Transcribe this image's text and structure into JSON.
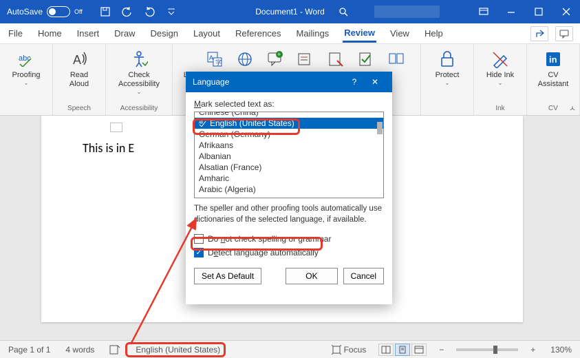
{
  "titlebar": {
    "autosave_label": "AutoSave",
    "autosave_state": "Off",
    "document_title": "Document1 - Word"
  },
  "tabs": {
    "file": "File",
    "home": "Home",
    "insert": "Insert",
    "draw": "Draw",
    "design": "Design",
    "layout": "Layout",
    "references": "References",
    "mailings": "Mailings",
    "review": "Review",
    "view": "View",
    "help": "Help"
  },
  "ribbon": {
    "proofing": {
      "button": "Proofing",
      "group": ""
    },
    "speech": {
      "button": "Read Aloud",
      "group": "Speech"
    },
    "accessibility": {
      "button": "Check Accessibility",
      "group": "Accessibility"
    },
    "language": {
      "button": "Lang",
      "group": ""
    },
    "protect": {
      "button": "Protect",
      "group": ""
    },
    "ink": {
      "button": "Hide Ink",
      "group": "Ink"
    },
    "cv": {
      "button": "CV Assistant",
      "group": "CV"
    }
  },
  "document": {
    "visible_text": "This is in E"
  },
  "dialog": {
    "title": "Language",
    "mark_label_pre": "",
    "mark_underline": "M",
    "mark_label_post": "ark selected text as:",
    "languages": {
      "l0": "Chinese (China)",
      "l1": "English (United States)",
      "l2": "German (Germany)",
      "l3": "Afrikaans",
      "l4": "Albanian",
      "l5": "Alsatian (France)",
      "l6": "Amharic",
      "l7": "Arabic (Algeria)"
    },
    "info_text": "The speller and other proofing tools automatically use dictionaries of the selected language, if available.",
    "no_check_pre": "Do ",
    "no_check_u": "n",
    "no_check_post": "ot check spelling or grammar",
    "detect_pre": "D",
    "detect_u": "e",
    "detect_post": "tect language automatically",
    "set_default": "Set As Default",
    "ok": "OK",
    "cancel": "Cancel"
  },
  "statusbar": {
    "page": "Page 1 of 1",
    "words": "4 words",
    "language": "English (United States)",
    "focus": "Focus",
    "zoom": "130%"
  }
}
